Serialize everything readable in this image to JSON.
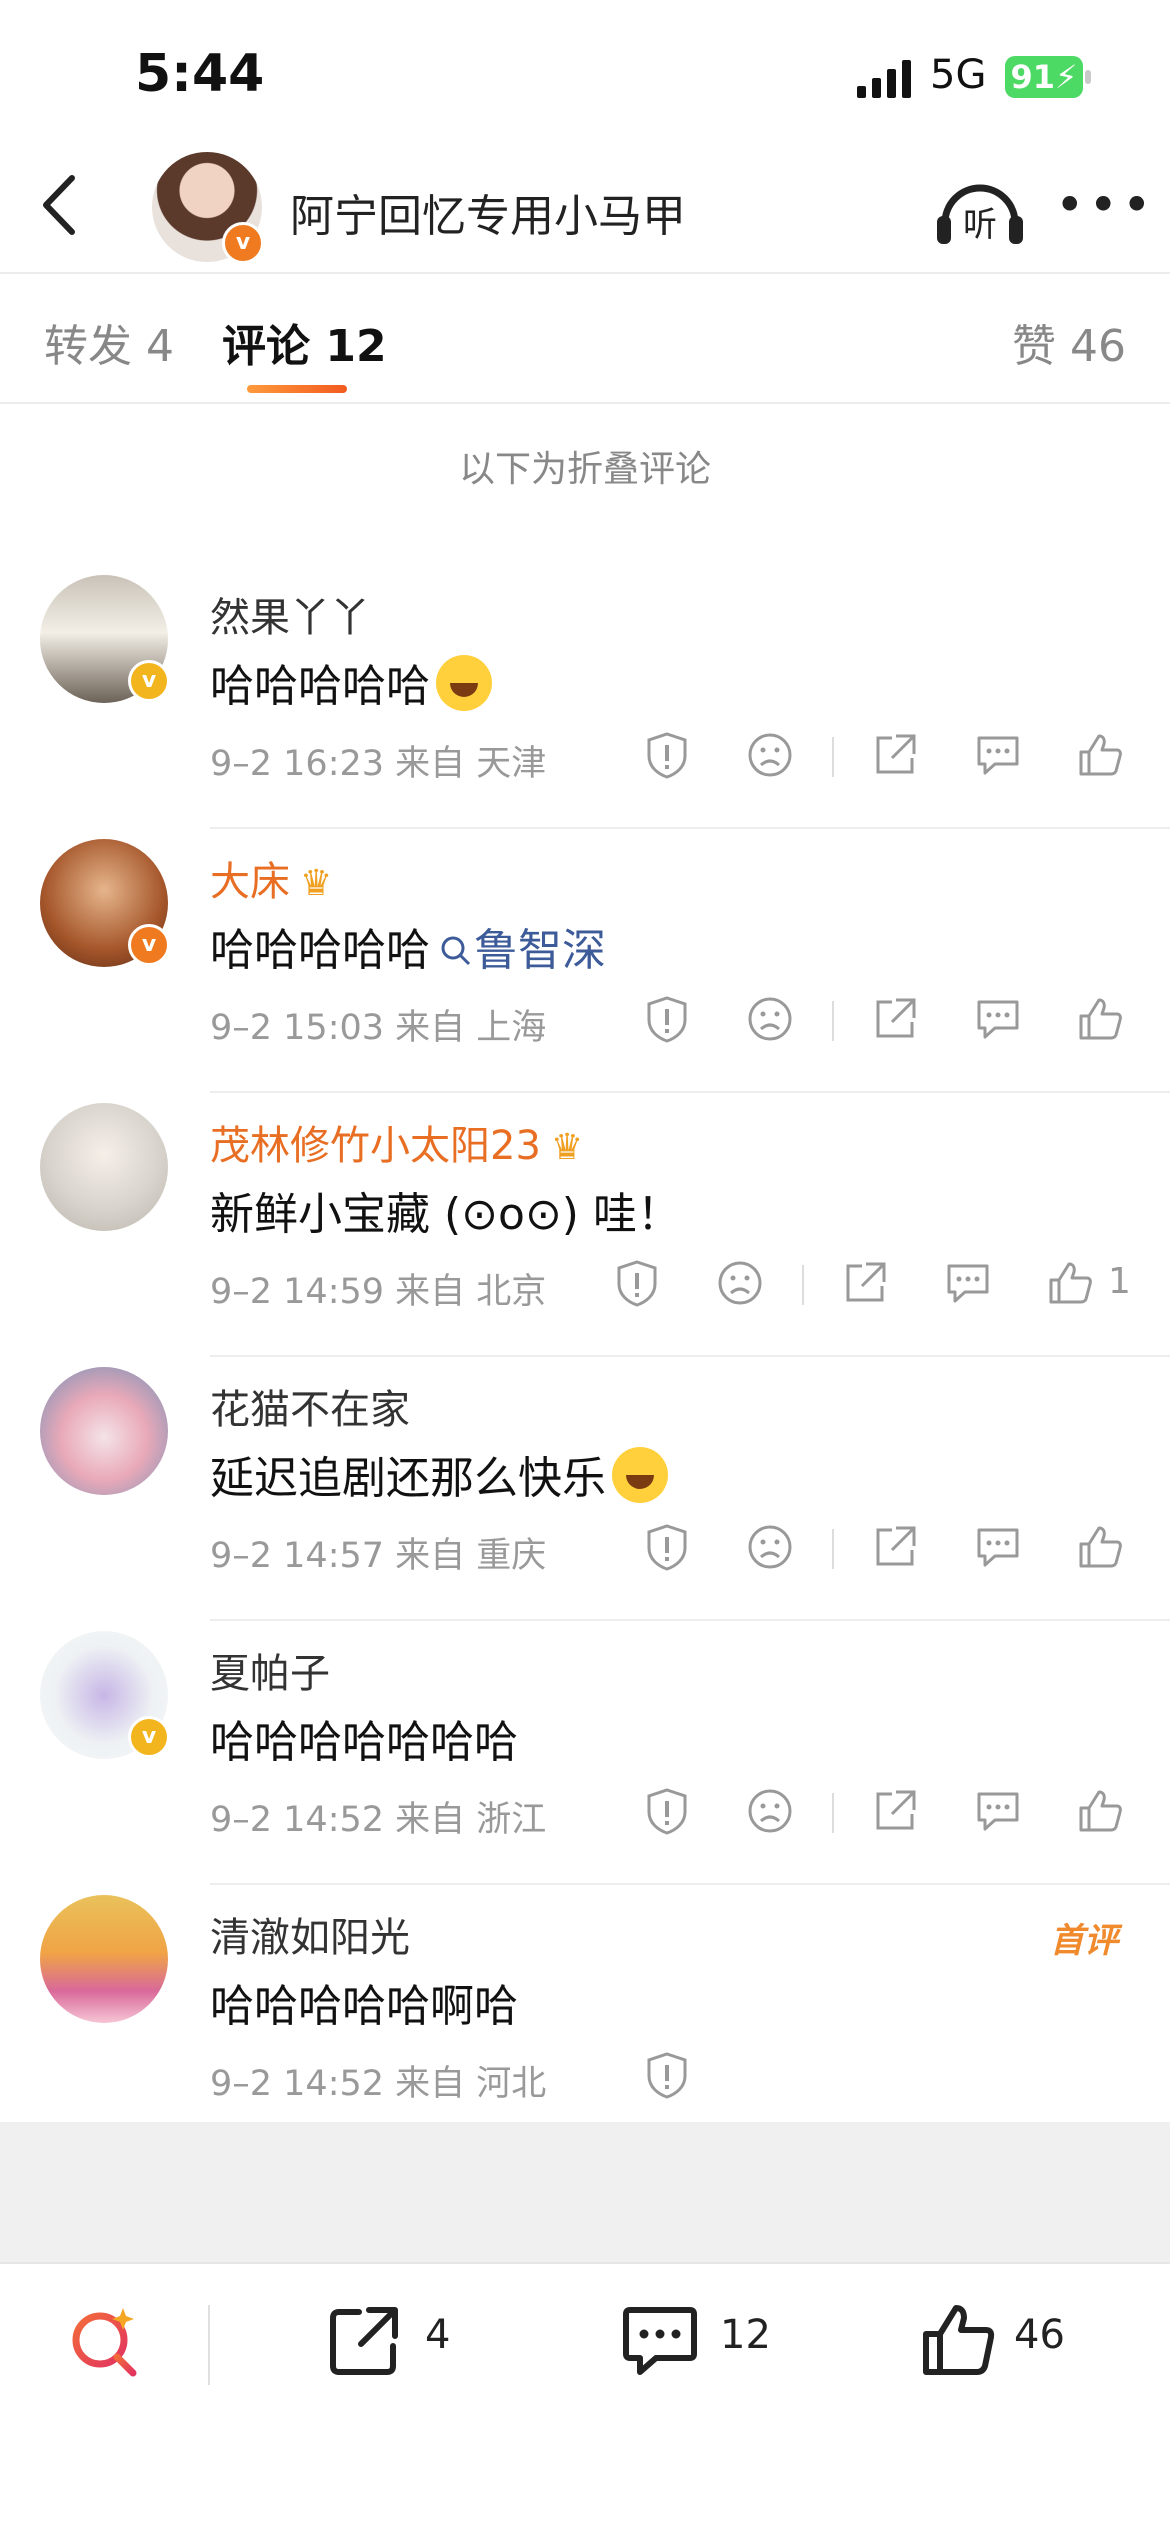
{
  "status": {
    "time": "5:44",
    "network": "5G",
    "battery": "91"
  },
  "header": {
    "title": "阿宁回忆专用小马甲",
    "listen_label": "听"
  },
  "tabs": [
    {
      "label": "转发",
      "count": "4"
    },
    {
      "label": "评论",
      "count": "12"
    },
    {
      "label": "赞",
      "count": "46"
    }
  ],
  "fold_note": "以下为折叠评论",
  "comments": [
    {
      "name": "然果丫丫",
      "text": "哈哈哈哈哈",
      "time": "9–2 16:23",
      "location": "来自 天津"
    },
    {
      "name": "大床",
      "text": "哈哈哈哈哈",
      "search_link": "鲁智深",
      "time": "9–2 15:03",
      "location": "来自 上海"
    },
    {
      "name": "茂林修竹小太阳23",
      "text": "新鲜小宝藏 (⊙o⊙) 哇！",
      "time": "9–2 14:59",
      "location": "来自 北京",
      "like_count": "1"
    },
    {
      "name": "花猫不在家",
      "text": "延迟追剧还那么快乐",
      "time": "9–2 14:57",
      "location": "来自 重庆"
    },
    {
      "name": "夏帕子",
      "text": "哈哈哈哈哈哈哈",
      "time": "9–2 14:52",
      "location": "来自 浙江"
    },
    {
      "name": "清澈如阳光",
      "text": "哈哈哈哈哈啊哈",
      "time": "9–2 14:52",
      "location": "来自 河北",
      "tag": "首评"
    }
  ],
  "bottom_bar": {
    "repost_count": "4",
    "comment_count": "12",
    "like_count": "46"
  },
  "colors": {
    "accent": "#f07a1f",
    "vip_name": "#e86e23",
    "link": "#3d5b99",
    "battery": "#4cd964"
  }
}
